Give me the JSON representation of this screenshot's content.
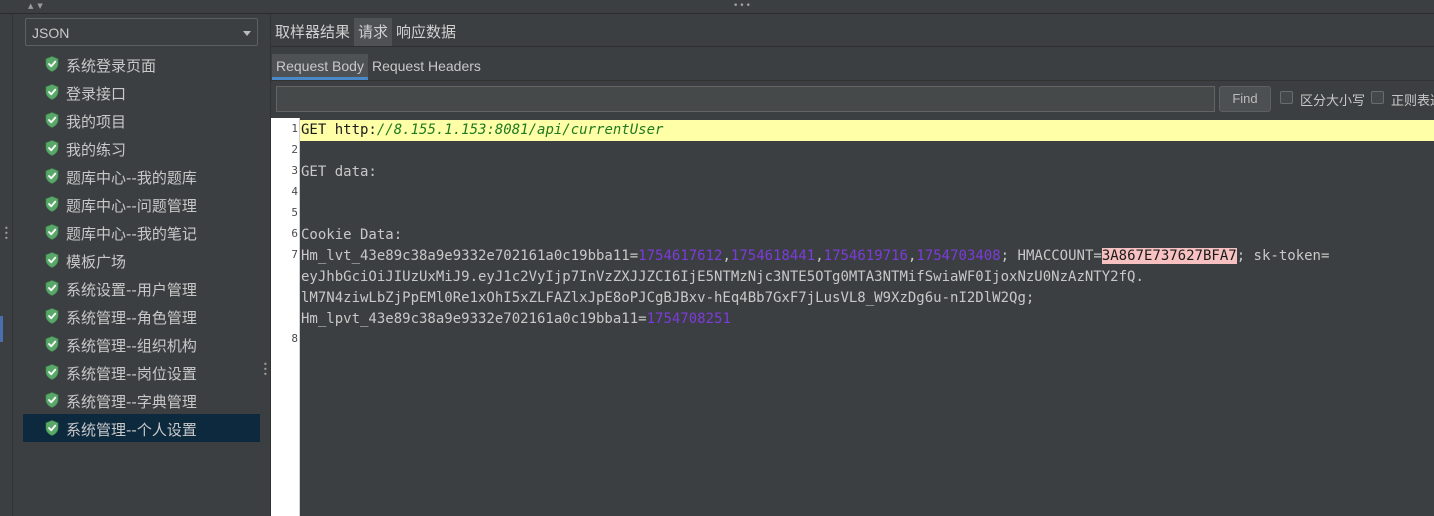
{
  "sidebar": {
    "selector_value": "JSON",
    "items": [
      {
        "label": "系统登录页面"
      },
      {
        "label": "登录接口"
      },
      {
        "label": "我的项目"
      },
      {
        "label": "我的练习"
      },
      {
        "label": "题库中心--我的题库"
      },
      {
        "label": "题库中心--问题管理"
      },
      {
        "label": "题库中心--我的笔记"
      },
      {
        "label": "模板广场"
      },
      {
        "label": "系统设置--用户管理"
      },
      {
        "label": "系统管理--角色管理"
      },
      {
        "label": "系统管理--组织机构"
      },
      {
        "label": "系统管理--岗位设置"
      },
      {
        "label": "系统管理--字典管理"
      },
      {
        "label": "系统管理--个人设置"
      }
    ],
    "selected_index": 13
  },
  "result_tabs": [
    "取样器结果",
    "请求",
    "响应数据"
  ],
  "result_tabs_active": 1,
  "request_tabs": [
    "Request Body",
    "Request Headers"
  ],
  "request_tabs_active": 0,
  "search": {
    "value": "",
    "find_label": "Find",
    "case_label": "区分大小写",
    "regex_label": "正则表达"
  },
  "editor": {
    "line_numbers": [
      "1",
      "2",
      "3",
      "4",
      "5",
      "6",
      "7",
      "8"
    ],
    "line1": {
      "method": "GET ",
      "scheme": "http:",
      "url": "//8.155.1.153:8081/api/currentUser"
    },
    "line3": "GET data:",
    "line6": "Cookie Data:",
    "line7": {
      "hm_lvt_key": "Hm_lvt_43e89c38a9e9332e702161a0c19bba11",
      "eq1": "=",
      "ts1": "1754617612",
      "ts2": "1754618441",
      "ts3": "1754619716",
      "ts4": "1754703408",
      "sep1": "; HMACCOUNT=",
      "hmaccount": "3A867E737627BFA7",
      "sk_prefix": "; sk-token=",
      "token_line2": "eyJhbGciOiJIUzUxMiJ9.eyJ1c2VyIjp7InVzZXJJZCI6IjE5NTMzNjc3NTE5OTg0MTA3NTMifSwiaWF0IjoxNzU0NzAzNTY2fQ.",
      "token_line3": "lM7N4ziwLbZjPpEMl0Re1xOhI5xZLFAZlxJpE8oPJCgBJBxv-hEq4Bb7GxF7jLusVL8_W9XzDg6u-nI2DlW2Qg;",
      "hm_lpvt_key": "Hm_lpvt_43e89c38a9e9332e702161a0c19bba11",
      "eq2": "=",
      "ts5": "1754708251"
    }
  },
  "colors": {
    "background": "#3c3f41",
    "selected_row": "#0d293e",
    "highlight_line": "#ffffa8",
    "timestamp": "#7c3bdc",
    "url": "#1f7a1f",
    "hmaccount_highlight": "#f7c1c1",
    "success_icon": "#59a869"
  }
}
